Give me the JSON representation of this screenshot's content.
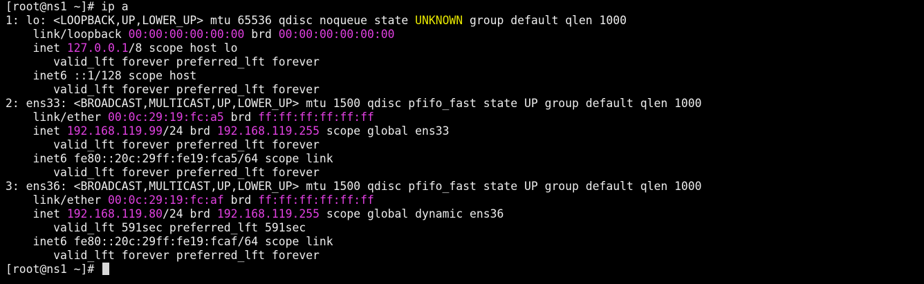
{
  "terminal": {
    "background": "#000000",
    "foreground": "#ececec",
    "address_color": "#e040e0",
    "state_color": "#e6e600",
    "cursor_color": "#d8d8d8",
    "lines": [
      {
        "segs": [
          {
            "t": "[root@ns1 ~]# ip a"
          }
        ]
      },
      {
        "segs": [
          {
            "t": "1: lo: <LOOPBACK,UP,LOWER_UP> mtu 65536 qdisc noqueue state "
          },
          {
            "t": "UNKNOWN",
            "c": "warn"
          },
          {
            "t": " group default qlen 1000"
          }
        ]
      },
      {
        "segs": [
          {
            "t": "    link/loopback "
          },
          {
            "t": "00:00:00:00:00:00",
            "c": "addr"
          },
          {
            "t": " brd "
          },
          {
            "t": "00:00:00:00:00:00",
            "c": "addr"
          }
        ]
      },
      {
        "segs": [
          {
            "t": "    inet "
          },
          {
            "t": "127.0.0.1",
            "c": "addr"
          },
          {
            "t": "/8 scope host lo"
          }
        ]
      },
      {
        "segs": [
          {
            "t": "       valid_lft forever preferred_lft forever"
          }
        ]
      },
      {
        "segs": [
          {
            "t": "    inet6 ::1/128 scope host"
          }
        ]
      },
      {
        "segs": [
          {
            "t": "       valid_lft forever preferred_lft forever"
          }
        ]
      },
      {
        "segs": [
          {
            "t": "2: ens33: <BROADCAST,MULTICAST,UP,LOWER_UP> mtu 1500 qdisc pfifo_fast state UP group default qlen 1000"
          }
        ]
      },
      {
        "segs": [
          {
            "t": "    link/ether "
          },
          {
            "t": "00:0c:29:19:fc:a5",
            "c": "addr"
          },
          {
            "t": " brd "
          },
          {
            "t": "ff:ff:ff:ff:ff:ff",
            "c": "addr"
          }
        ]
      },
      {
        "segs": [
          {
            "t": "    inet "
          },
          {
            "t": "192.168.119.99",
            "c": "addr"
          },
          {
            "t": "/24 brd "
          },
          {
            "t": "192.168.119.255",
            "c": "addr"
          },
          {
            "t": " scope global ens33"
          }
        ]
      },
      {
        "segs": [
          {
            "t": "       valid_lft forever preferred_lft forever"
          }
        ]
      },
      {
        "segs": [
          {
            "t": "    inet6 fe80::20c:29ff:fe19:fca5/64 scope link"
          }
        ]
      },
      {
        "segs": [
          {
            "t": "       valid_lft forever preferred_lft forever"
          }
        ]
      },
      {
        "segs": [
          {
            "t": "3: ens36: <BROADCAST,MULTICAST,UP,LOWER_UP> mtu 1500 qdisc pfifo_fast state UP group default qlen 1000"
          }
        ]
      },
      {
        "segs": [
          {
            "t": "    link/ether "
          },
          {
            "t": "00:0c:29:19:fc:af",
            "c": "addr"
          },
          {
            "t": " brd "
          },
          {
            "t": "ff:ff:ff:ff:ff:ff",
            "c": "addr"
          }
        ]
      },
      {
        "segs": [
          {
            "t": "    inet "
          },
          {
            "t": "192.168.119.80",
            "c": "addr"
          },
          {
            "t": "/24 brd "
          },
          {
            "t": "192.168.119.255",
            "c": "addr"
          },
          {
            "t": " scope global dynamic ens36"
          }
        ]
      },
      {
        "segs": [
          {
            "t": "       valid_lft 591sec preferred_lft 591sec"
          }
        ]
      },
      {
        "segs": [
          {
            "t": "    inet6 fe80::20c:29ff:fe19:fcaf/64 scope link"
          }
        ]
      },
      {
        "segs": [
          {
            "t": "       valid_lft forever preferred_lft forever"
          }
        ]
      }
    ],
    "prompt": "[root@ns1 ~]# "
  }
}
